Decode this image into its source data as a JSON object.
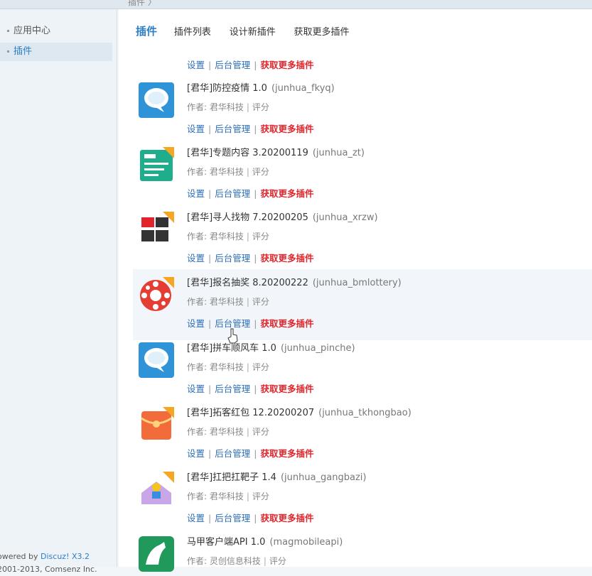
{
  "header": {
    "crumb": "插件 〉"
  },
  "sidebar": {
    "items": [
      {
        "label": "应用中心"
      },
      {
        "label": "插件"
      }
    ],
    "powered_prefix": "owered by ",
    "powered_brand": "Discuz! X3.2",
    "copyright": "2001-2013, Comsenz Inc."
  },
  "tabs": [
    {
      "label": "插件"
    },
    {
      "label": "插件列表"
    },
    {
      "label": "设计新插件"
    },
    {
      "label": "获取更多插件"
    }
  ],
  "actions": {
    "settings": "设置",
    "backend": "后台管理",
    "more": "获取更多插件",
    "sep": "|"
  },
  "plugins": [
    {
      "title": "[君华]防控疫情 1.0",
      "ident": "(junhua_fkyq)",
      "author": "作者: 君华科技",
      "rate": "评分",
      "icon": "chat-bubble-icon"
    },
    {
      "title": "[君华]专题内容 3.20200119",
      "ident": "(junhua_zt)",
      "author": "作者: 君华科技",
      "rate": "评分",
      "icon": "topic-icon"
    },
    {
      "title": "[君华]寻人找物 7.20200205",
      "ident": "(junhua_xrzw)",
      "author": "作者: 君华科技",
      "rate": "评分",
      "icon": "find-person-icon"
    },
    {
      "title": "[君华]报名抽奖 8.20200222",
      "ident": "(junhua_bmlottery)",
      "author": "作者: 君华科技",
      "rate": "评分",
      "icon": "lottery-wheel-icon"
    },
    {
      "title": "[君华]拼车顺风车 1.0",
      "ident": "(junhua_pinche)",
      "author": "作者: 君华科技",
      "rate": "评分",
      "icon": "chat-bubble-icon"
    },
    {
      "title": "[君华]拓客红包 12.20200207",
      "ident": "(junhua_tkhongbao)",
      "author": "作者: 君华科技",
      "rate": "评分",
      "icon": "red-envelope-icon"
    },
    {
      "title": "[君华]扛把扛靶子 1.4",
      "ident": "(junhua_gangbazi)",
      "author": "作者: 君华科技",
      "rate": "评分",
      "icon": "mail-person-icon"
    },
    {
      "title": "马甲客户端API 1.0",
      "ident": "(magmobileapi)",
      "author": "作者: 灵创信息科技",
      "rate": "评分",
      "icon": "horse-logo-icon"
    }
  ],
  "colors": {
    "link": "#2c6fb7",
    "more": "#e0262c",
    "accent": "#2c7fc7"
  }
}
